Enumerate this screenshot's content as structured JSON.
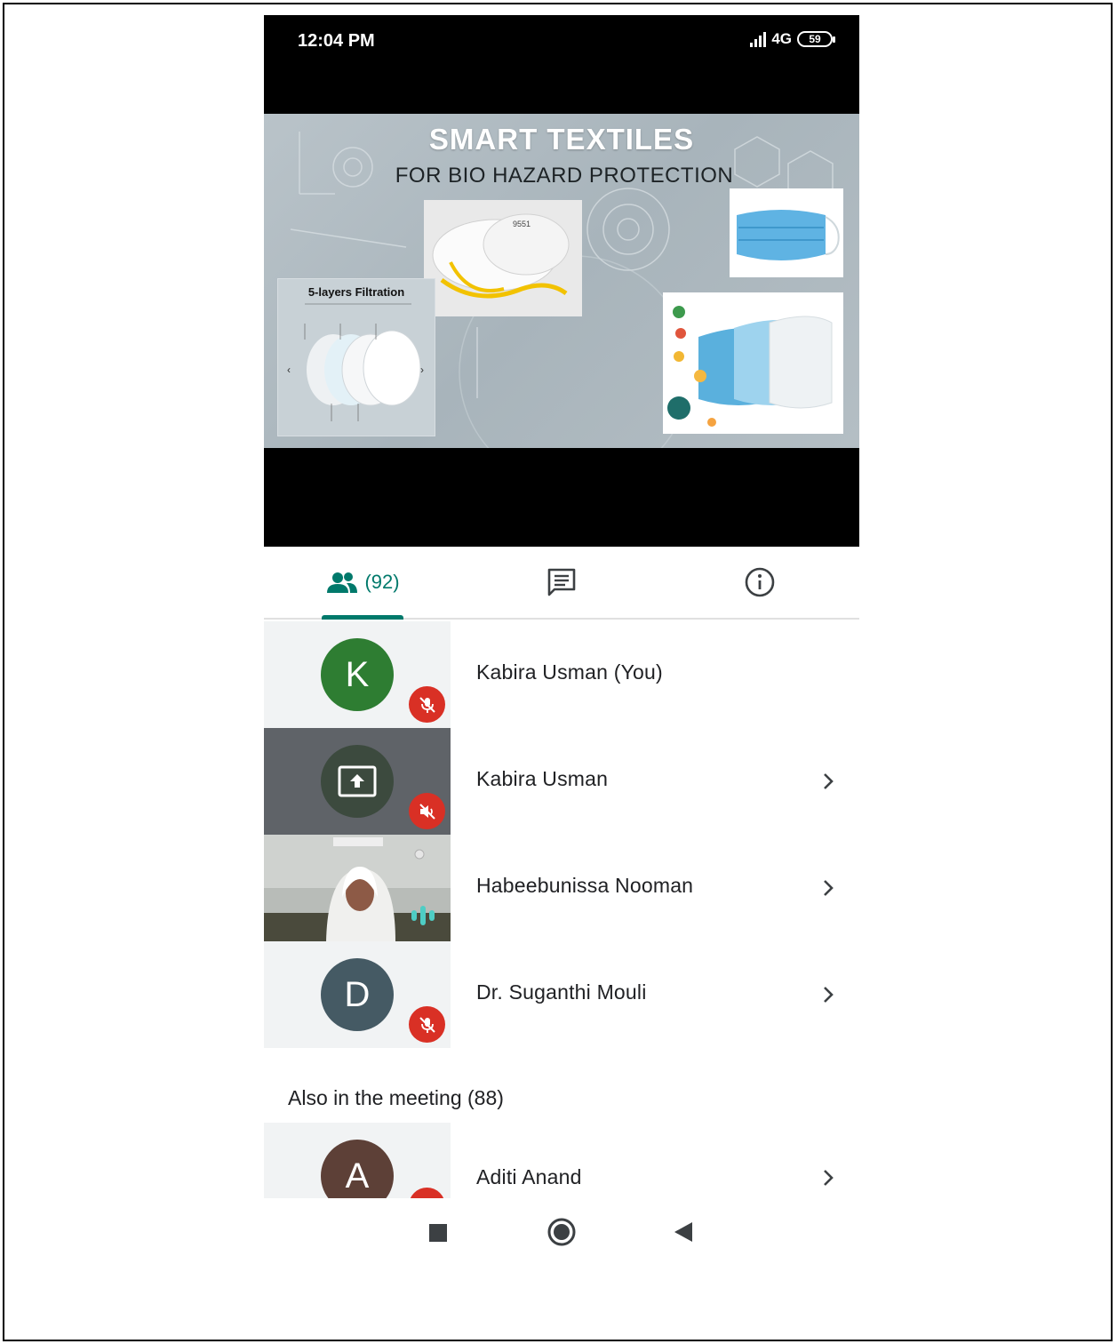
{
  "status_bar": {
    "time": "12:04 PM",
    "network": "4G",
    "battery": "59"
  },
  "slide": {
    "title": "SMART TEXTILES",
    "subtitle": "FOR BIO HAZARD PROTECTION",
    "filter_panel_title": "5-layers Filtration"
  },
  "tabs": {
    "people_count": "(92)",
    "people_icon": "people-icon",
    "chat_icon": "chat-icon",
    "info_icon": "info-icon"
  },
  "participants": [
    {
      "initial": "K",
      "name": "Kabira Usman (You)",
      "avatar_color": "#2e7d32",
      "status": "mic-off"
    },
    {
      "initial": "",
      "name": "Kabira Usman",
      "avatar_color": "#3c4a3e",
      "status": "volume-off"
    },
    {
      "initial": "",
      "name": "Habeebunissa Nooman",
      "avatar_color": "",
      "status": "speaking"
    },
    {
      "initial": "D",
      "name": "Dr. Suganthi Mouli",
      "avatar_color": "#455a64",
      "status": "mic-off"
    }
  ],
  "also_in_meeting": {
    "label": "Also in the meeting (88)",
    "items": [
      {
        "initial": "A",
        "name": "Aditi Anand",
        "avatar_color": "#5d4037",
        "status": "mic-off"
      }
    ]
  },
  "colors": {
    "accent": "#00796b",
    "mute_red": "#d93025",
    "speaking": "#4ecdc4"
  }
}
